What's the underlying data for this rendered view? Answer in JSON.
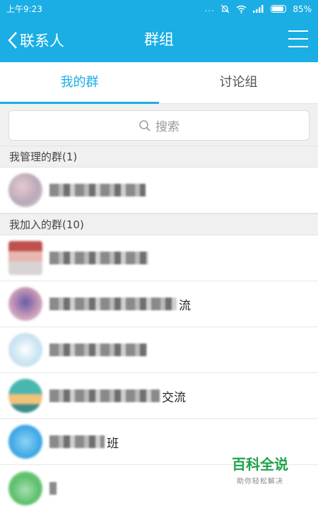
{
  "status_bar": {
    "time": "上午9:23",
    "signal": "...",
    "battery": "85%"
  },
  "nav": {
    "back_label": "联系人",
    "title": "群组"
  },
  "tabs": [
    {
      "label": "我的群",
      "active": true
    },
    {
      "label": "讨论组",
      "active": false
    }
  ],
  "search": {
    "placeholder": "搜索"
  },
  "sections": {
    "managed": {
      "header": "我管理的群(1)"
    },
    "joined": {
      "header": "我加入的群(10)"
    }
  },
  "groups": [
    {
      "visible_name": ""
    },
    {
      "visible_name": ""
    },
    {
      "visible_name": "流"
    },
    {
      "visible_name": ""
    },
    {
      "visible_name": "交流"
    },
    {
      "visible_name": "班"
    },
    {
      "visible_name": ""
    }
  ],
  "watermark": {
    "title": "百科全说",
    "subtitle": "助你轻松解决"
  },
  "colors": {
    "accent": "#1aaee4",
    "watermark": "#1ea34a"
  }
}
